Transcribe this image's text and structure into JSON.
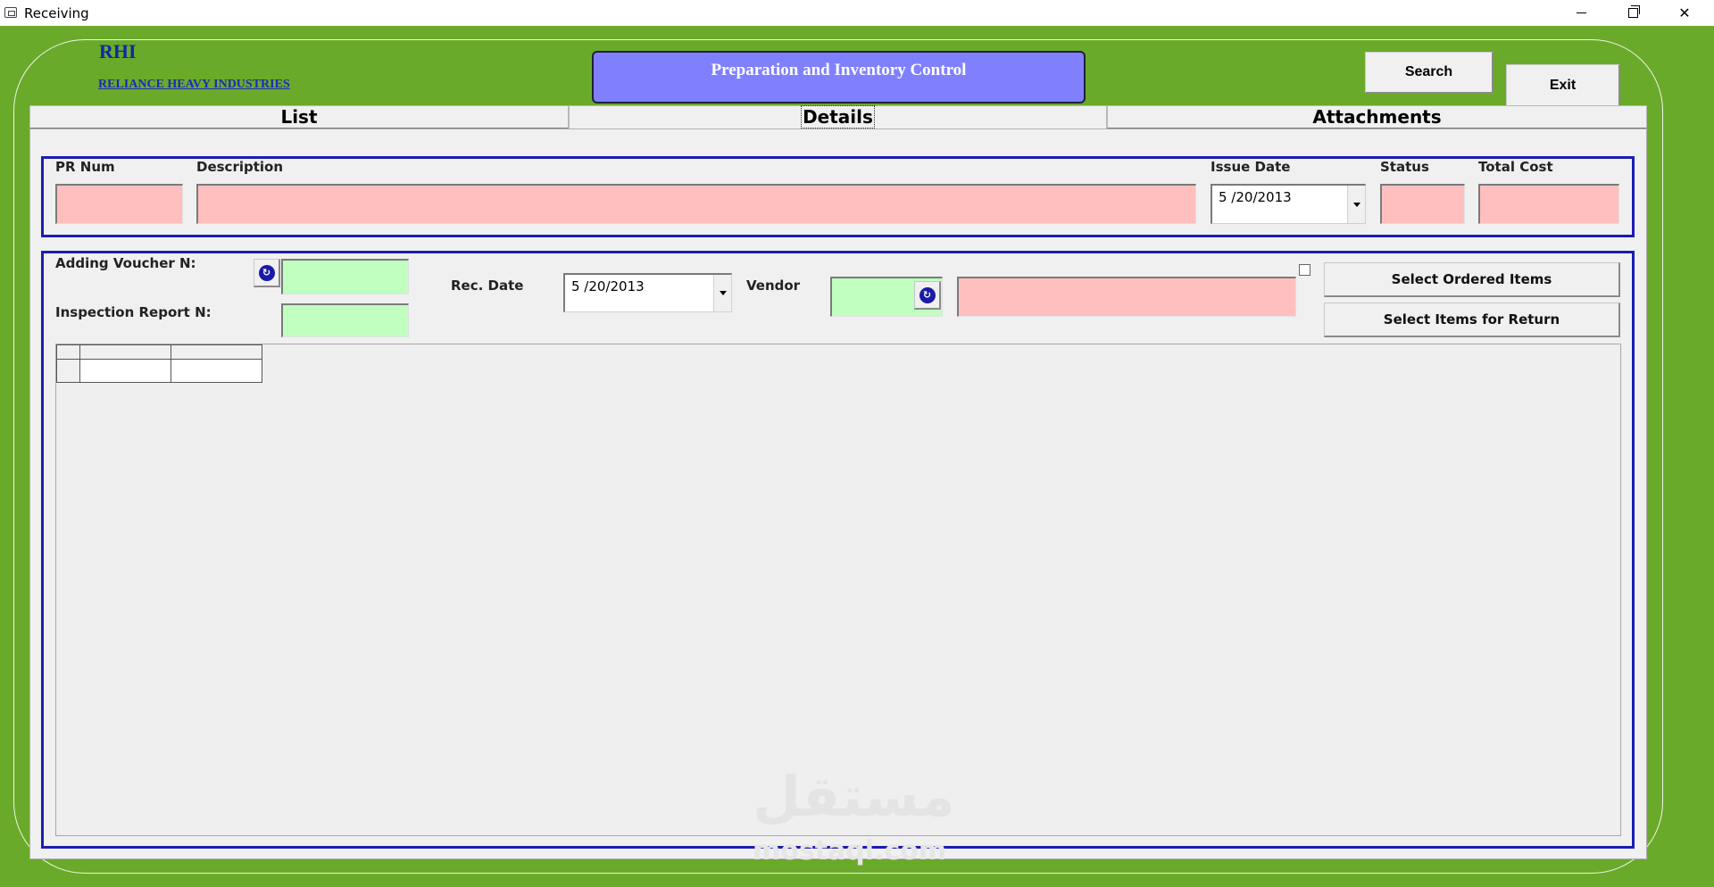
{
  "window": {
    "title": "Receiving"
  },
  "logo": {
    "abbr": "RHI",
    "company": "RELIANCE HEAVY INDUSTRIES"
  },
  "banner": {
    "title": "Preparation and Inventory Control"
  },
  "top_buttons": {
    "search": "Search",
    "exit": "Exit"
  },
  "tabs": [
    {
      "label": "List"
    },
    {
      "label": "Details"
    },
    {
      "label": "Attachments"
    }
  ],
  "header_section": {
    "pr_num_label": "PR Num",
    "description_label": "Description",
    "issue_date_label": "Issue Date",
    "issue_date_value": "5 /20/2013",
    "status_label": "Status",
    "total_cost_label": "Total Cost"
  },
  "receiving_section": {
    "adding_voucher_label": "Adding Voucher N:",
    "inspection_report_label": "Inspection Report N:",
    "rec_date_label": "Rec. Date",
    "rec_date_value": "5 /20/2013",
    "vendor_label": "Vendor",
    "select_ordered_items": "Select Ordered Items",
    "select_items_for_return": "Select Items for Return"
  },
  "watermark": {
    "text": "مستقل",
    "sub": "mostaql.com"
  },
  "colors": {
    "background": "#6aaa2a",
    "required_field": "#ffbfbf",
    "lookup_field": "#c0ffc0",
    "banner": "#8080ff",
    "group_border": "#1c1cb4"
  }
}
